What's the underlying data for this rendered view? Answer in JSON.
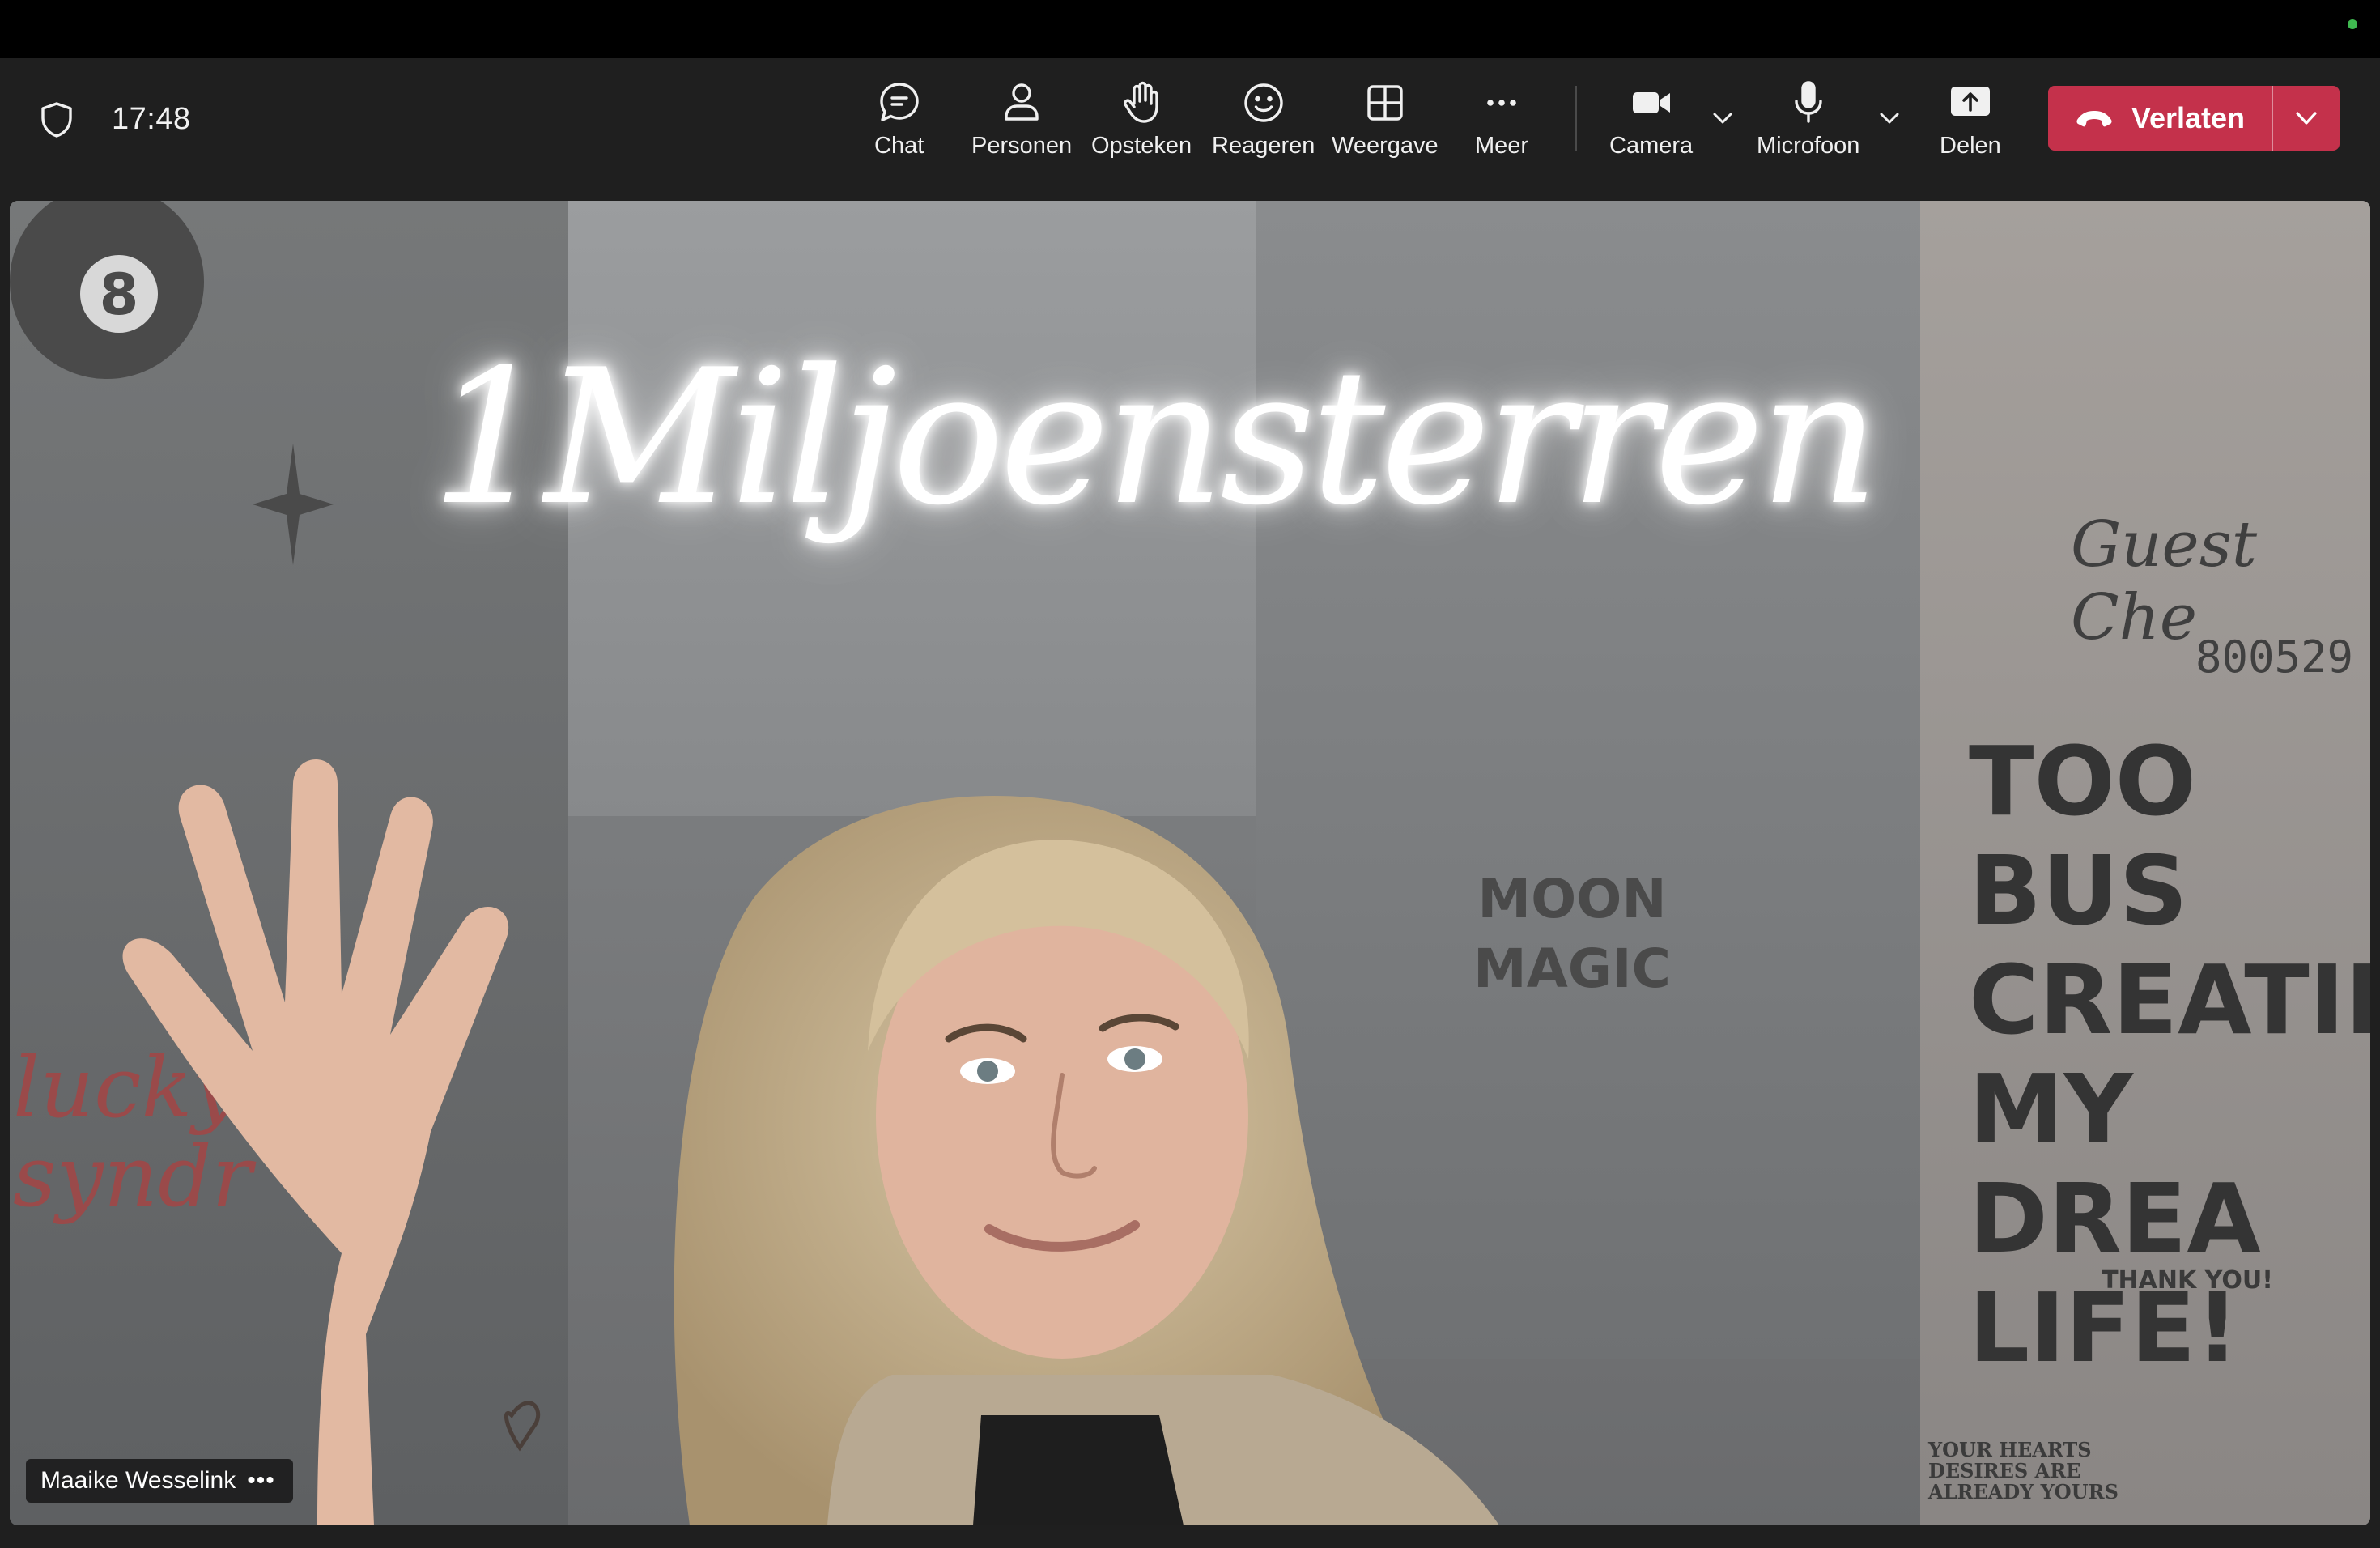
{
  "meeting": {
    "time": "17:48"
  },
  "toolbar": {
    "chat_label": "Chat",
    "people_label": "Personen",
    "raise_label": "Opsteken",
    "react_label": "Reageren",
    "view_label": "Weergave",
    "more_label": "Meer",
    "camera_label": "Camera",
    "mic_label": "Microfoon",
    "share_label": "Delen",
    "leave_label": "Verlaten"
  },
  "video": {
    "participant_name": "Maaike Wesselink",
    "more_label": "•••",
    "neon_sign": "1Miljoensterren",
    "poster_right": "TOO BUS\nCREATIN\nMY DREA\nLIFE!",
    "poster_right_footer": "THANK YOU!",
    "poster_center": "MOON\nMAGIC",
    "poster_bottom": "YOUR HEARTS\nDESIRES ARE\nALREADY YOURS",
    "guest_label": "Guest Che",
    "guest_number": "800529",
    "left_script": "lucky\nsyndr"
  },
  "colors": {
    "leave_button": "#c4314b",
    "toolbar_bg": "#1f1f1f",
    "status_dot": "#3fb950"
  },
  "icons": {
    "shield": "shield-icon",
    "chat": "chat-bubble-icon",
    "people": "person-icon",
    "raise": "raised-hand-icon",
    "react": "smiley-icon",
    "view": "grid-icon",
    "more": "ellipsis-icon",
    "camera": "video-camera-icon",
    "mic": "microphone-icon",
    "share": "share-upload-icon",
    "hangup": "phone-hangup-icon"
  }
}
